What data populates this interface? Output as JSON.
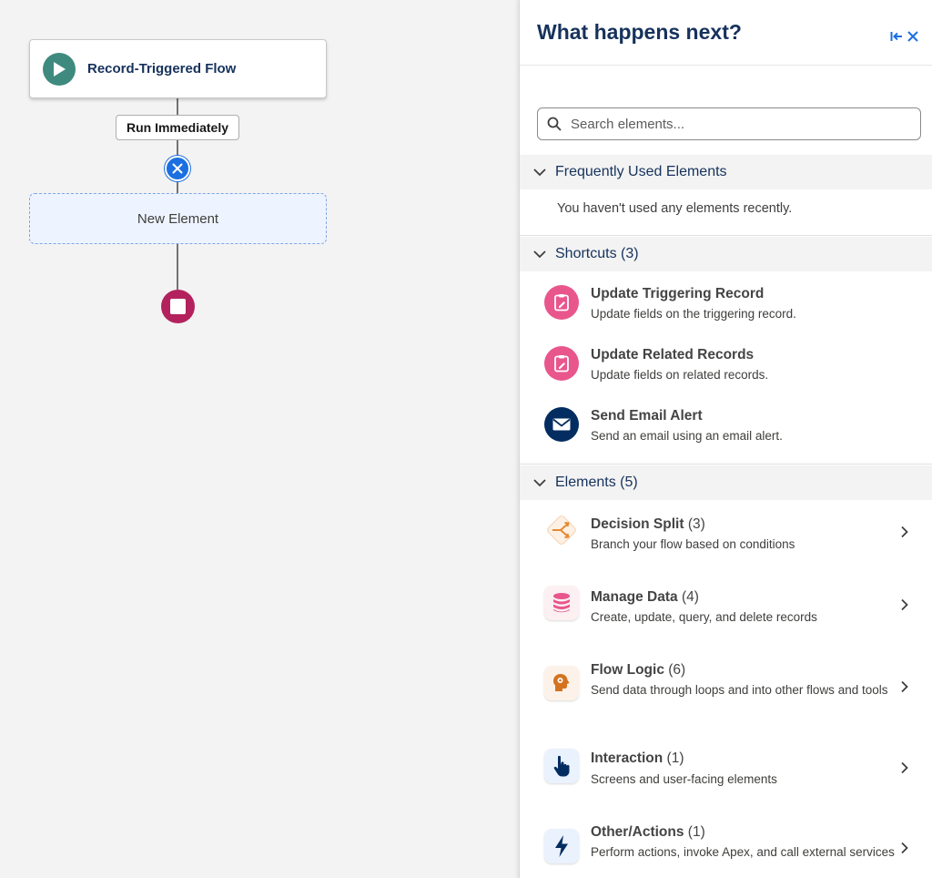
{
  "canvas": {
    "start_node": {
      "label": "Record-Triggered Flow",
      "icon": "play-icon"
    },
    "run_label": "Run Immediately",
    "new_element_label": "New Element",
    "end_icon": "stop-icon"
  },
  "panel": {
    "title": "What happens next?",
    "search": {
      "placeholder": "Search elements...",
      "value": ""
    },
    "frequent": {
      "label": "Frequently Used Elements",
      "empty_message": "You haven't used any elements recently."
    },
    "shortcuts": {
      "label": "Shortcuts (3)",
      "items": [
        {
          "title": "Update Triggering Record",
          "desc": "Update fields on the triggering record.",
          "icon": "clipboard-edit-icon",
          "color": "#e8568c"
        },
        {
          "title": "Update Related Records",
          "desc": "Update fields on related records.",
          "icon": "clipboard-edit-icon",
          "color": "#e8568c"
        },
        {
          "title": "Send Email Alert",
          "desc": "Send an email using an email alert.",
          "icon": "email-icon",
          "color": "#032d60"
        }
      ]
    },
    "elements": {
      "label": "Elements (5)",
      "items": [
        {
          "title": "Decision Split",
          "count": "(3)",
          "desc": "Branch your flow based on conditions",
          "icon": "decision-icon",
          "color": "#e48a2f"
        },
        {
          "title": "Manage Data",
          "count": "(4)",
          "desc": "Create, update, query, and delete records",
          "icon": "database-icon",
          "color": "#e8568c"
        },
        {
          "title": "Flow Logic",
          "count": "(6)",
          "desc": "Send data through loops and into other flows and tools",
          "icon": "logic-head-icon",
          "color": "#d4731f"
        },
        {
          "title": "Interaction",
          "count": "(1)",
          "desc": "Screens and user-facing elements",
          "icon": "touch-icon",
          "color": "#032d60"
        },
        {
          "title": "Other/Actions",
          "count": "(1)",
          "desc": "Perform actions, invoke Apex, and call external services",
          "icon": "lightning-icon",
          "color": "#032d60"
        }
      ]
    }
  }
}
